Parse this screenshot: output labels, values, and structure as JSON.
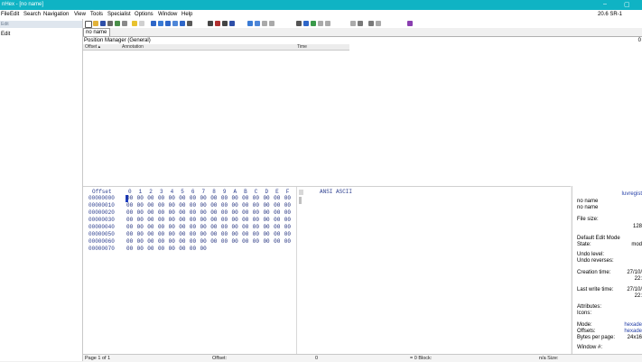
{
  "window": {
    "title": "nHex - [no name]",
    "minimize": "–",
    "maximize": "▢"
  },
  "menu": [
    "File",
    "Edit",
    "Search",
    "Navigation",
    "View",
    "Tools",
    "Specialist",
    "Options",
    "Window",
    "Help"
  ],
  "version": "20.6 SR-1",
  "left_panel": {
    "header": "Edit",
    "edit_label": "Edit"
  },
  "tab": {
    "label": "no name"
  },
  "position_manager": {
    "title": "Position Manager (General)",
    "count": "0",
    "columns": [
      "Offset ▴",
      "Annotation",
      "Time"
    ]
  },
  "hex": {
    "header": {
      "offset": "Offset",
      "columns": [
        "0",
        "1",
        "2",
        "3",
        "4",
        "5",
        "6",
        "7",
        "8",
        "9",
        "A",
        "B",
        "C",
        "D",
        "E",
        "F"
      ],
      "text": "ANSI ASCII"
    },
    "rows": [
      {
        "offset": "00000000",
        "bytes": [
          "00",
          "00",
          "00",
          "00",
          "00",
          "00",
          "00",
          "00",
          "00",
          "00",
          "00",
          "00",
          "00",
          "00",
          "00",
          "00"
        ]
      },
      {
        "offset": "00000010",
        "bytes": [
          "00",
          "00",
          "00",
          "00",
          "00",
          "00",
          "00",
          "00",
          "00",
          "00",
          "00",
          "00",
          "00",
          "00",
          "00",
          "00"
        ]
      },
      {
        "offset": "00000020",
        "bytes": [
          "00",
          "00",
          "00",
          "00",
          "00",
          "00",
          "00",
          "00",
          "00",
          "00",
          "00",
          "00",
          "00",
          "00",
          "00",
          "00"
        ]
      },
      {
        "offset": "00000030",
        "bytes": [
          "00",
          "00",
          "00",
          "00",
          "00",
          "00",
          "00",
          "00",
          "00",
          "00",
          "00",
          "00",
          "00",
          "00",
          "00",
          "00"
        ]
      },
      {
        "offset": "00000040",
        "bytes": [
          "00",
          "00",
          "00",
          "00",
          "00",
          "00",
          "00",
          "00",
          "00",
          "00",
          "00",
          "00",
          "00",
          "00",
          "00",
          "00"
        ]
      },
      {
        "offset": "00000050",
        "bytes": [
          "00",
          "00",
          "00",
          "00",
          "00",
          "00",
          "00",
          "00",
          "00",
          "00",
          "00",
          "00",
          "00",
          "00",
          "00",
          "00"
        ]
      },
      {
        "offset": "00000060",
        "bytes": [
          "00",
          "00",
          "00",
          "00",
          "00",
          "00",
          "00",
          "00",
          "00",
          "00",
          "00",
          "00",
          "00",
          "00",
          "00",
          "00"
        ]
      },
      {
        "offset": "00000070",
        "bytes": [
          "00",
          "00",
          "00",
          "00",
          "00",
          "00",
          "00",
          "00"
        ]
      }
    ]
  },
  "info_panel": {
    "title": "Iuvregist",
    "name1": "no name",
    "name2": "no name",
    "file_size_label": "File size:",
    "file_size_value": "128",
    "edit_mode_label": "Default Edit Mode",
    "state_label": "State:",
    "state_value": "mod",
    "undo_level_label": "Undo level:",
    "undo_reverses_label": "Undo reverses:",
    "creation_label": "Creation time:",
    "creation_date": "27/10/",
    "creation_time": "22:",
    "last_write_label": "Last write time:",
    "last_write_date": "27/10/",
    "last_write_time": "22:",
    "attributes_label": "Attributes:",
    "icons_label": "Icons:",
    "mode_label": "Mode:",
    "mode_value": "hexade",
    "offsets_label": "Offsets:",
    "offsets_value": "hexade",
    "bytes_per_page_label": "Bytes per page:",
    "bytes_per_page_value": "24x16",
    "window_label": "Window #:"
  },
  "status": {
    "page": "Page 1 of 1",
    "offset_label": "Offset:",
    "offset_value": "0",
    "block": "= 0  Block:",
    "size": "n/a  Size:"
  },
  "colors": {
    "titlebar": "#0fb3c4",
    "hex_text": "#1a2a7a",
    "cursor": "#1f3fbf"
  },
  "toolbar_icons": [
    "new-file-icon",
    "open-folder-icon",
    "save-icon",
    "print-icon",
    "properties-icon",
    "open-disk-icon",
    "cut-icon",
    "copy-icon",
    "paste-icon",
    "paste-special-icon",
    "clipboard-icon",
    "undo-icon",
    "find-icon",
    "find-hex-icon",
    "replace-icon",
    "replace-hex-icon",
    "goto-offset-icon",
    "goto-sector-icon",
    "back-icon",
    "forward-icon",
    "calculator-icon",
    "hash-icon",
    "disk-icon",
    "ram-icon",
    "snapshot-icon",
    "binoculars-icon",
    "analyze-icon",
    "hex-view-icon",
    "text-view-icon",
    "template-icon",
    "bookmark-icon",
    "help-icon"
  ]
}
